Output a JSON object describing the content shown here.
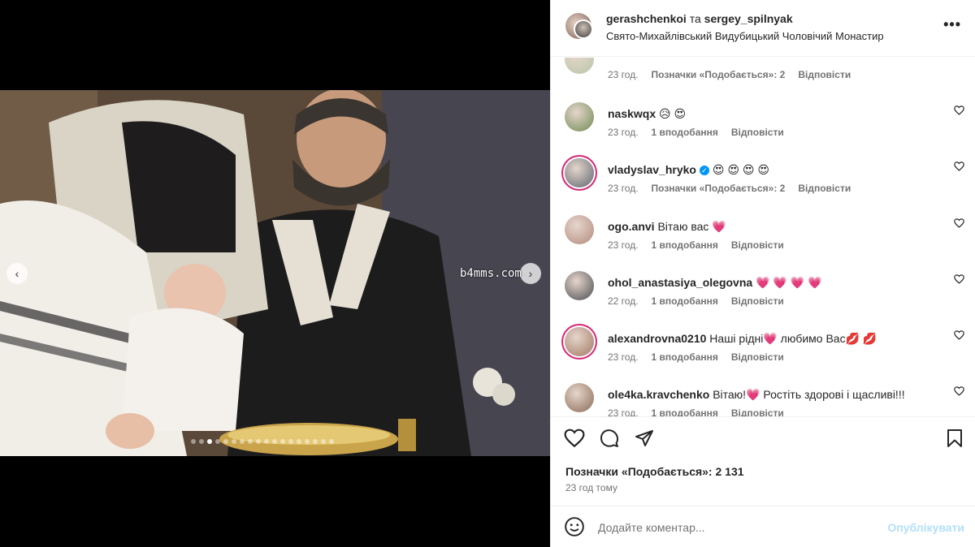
{
  "media": {
    "watermark": "b4mms.com",
    "prev_icon": "‹",
    "next_icon": "›",
    "dots": {
      "count": 18,
      "active_index": 2
    }
  },
  "header": {
    "user1": "gerashchenkoi",
    "connector": "та",
    "user2": "sergey_spilnyak",
    "location": "Свято-Михайлівський Видубицький Чоловічий Монастир",
    "more_icon": "•••"
  },
  "comments": [
    {
      "user": "",
      "text": "",
      "time": "23 год.",
      "likes": "Позначки «Подобається»: 2",
      "reply": "Відповісти",
      "story": false,
      "verified": false,
      "avatar": "#b7c7a8"
    },
    {
      "user": "naskwqx",
      "text": "😥 😍",
      "time": "23 год.",
      "likes": "1 вподобання",
      "reply": "Відповісти",
      "story": false,
      "verified": false,
      "avatar": "#6f8a52"
    },
    {
      "user": "vladyslav_hryko",
      "text": "😍 😍 😍 😍",
      "time": "23 год.",
      "likes": "Позначки «Подобається»: 2",
      "reply": "Відповісти",
      "story": true,
      "verified": true,
      "avatar": "#5c6670"
    },
    {
      "user": "ogo.anvi",
      "text": "Вітаю вас 💗",
      "time": "23 год.",
      "likes": "1 вподобання",
      "reply": "Відповісти",
      "story": false,
      "verified": false,
      "avatar": "#b48a7e"
    },
    {
      "user": "ohol_anastasiya_olegovna",
      "text": "💗 💗 💗 💗",
      "time": "22 год.",
      "likes": "1 вподобання",
      "reply": "Відповісти",
      "story": false,
      "verified": false,
      "avatar": "#4a4b4f"
    },
    {
      "user": "alexandrovna0210",
      "text": "Наші рідні💗 любимо Вас💋 💋",
      "time": "23 год.",
      "likes": "1 вподобання",
      "reply": "Відповісти",
      "story": true,
      "verified": false,
      "avatar": "#a07862"
    },
    {
      "user": "ole4ka.kravchenko",
      "text": "Вітаю!💗 Ростіть здорові і щасливі!!!",
      "time": "23 год.",
      "likes": "1 вподобання",
      "reply": "Відповісти",
      "story": false,
      "verified": false,
      "avatar": "#8a6a55"
    }
  ],
  "actions": {
    "like_icon": "heart-outline",
    "comment_icon": "comment-bubble",
    "share_icon": "paper-plane",
    "save_icon": "bookmark",
    "likes_text": "Позначки «Подобається»: 2 131",
    "time_text": "23 год тому"
  },
  "composer": {
    "emoji_icon": "☺",
    "placeholder": "Додайте коментар...",
    "publish_label": "Опублікувати"
  },
  "colors": {
    "accent_blue": "#0095f6",
    "publish_disabled": "#b2dffc",
    "story_ring": "#d62976"
  }
}
